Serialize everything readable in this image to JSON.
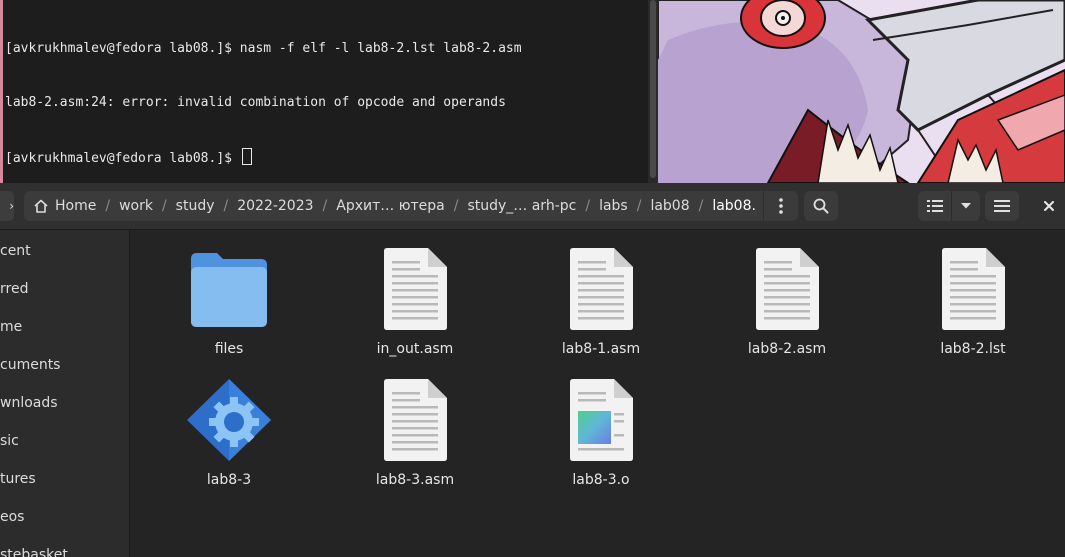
{
  "terminal": {
    "lines": [
      "[avkrukhmalev@fedora lab08.]$ nasm -f elf -l lab8-2.lst lab8-2.asm",
      "lab8-2.asm:24: error: invalid combination of opcode and operands",
      "[avkrukhmalev@fedora lab08.]$ "
    ]
  },
  "file_manager": {
    "breadcrumbs": [
      "Home",
      "work",
      "study",
      "2022-2023",
      "Архит… ютера",
      "study_… arh-pc",
      "labs",
      "lab08",
      "lab08."
    ],
    "back_icon": "chevron-left-icon",
    "home_icon": "home-icon",
    "more_icon": "vertical-dots-icon",
    "search_icon": "search-icon",
    "view_icon": "list-view-icon",
    "view_dropdown_icon": "chevron-down-icon",
    "menu_icon": "hamburger-menu-icon",
    "close_icon": "close-icon",
    "sidebar": [
      "cent",
      "rred",
      "me",
      "cuments",
      "wnloads",
      "sic",
      "tures",
      "eos",
      "stebasket"
    ],
    "files": [
      {
        "name": "files",
        "kind": "folder"
      },
      {
        "name": "in_out.asm",
        "kind": "text"
      },
      {
        "name": "lab8-1.asm",
        "kind": "text"
      },
      {
        "name": "lab8-2.asm",
        "kind": "text"
      },
      {
        "name": "lab8-2.lst",
        "kind": "text"
      },
      {
        "name": "lab8-3",
        "kind": "executable"
      },
      {
        "name": "lab8-3.asm",
        "kind": "text"
      },
      {
        "name": "lab8-3.o",
        "kind": "object"
      }
    ]
  },
  "colors": {
    "folder": "#7fb3e6",
    "accent": "#3584e4",
    "background": "#242424"
  }
}
